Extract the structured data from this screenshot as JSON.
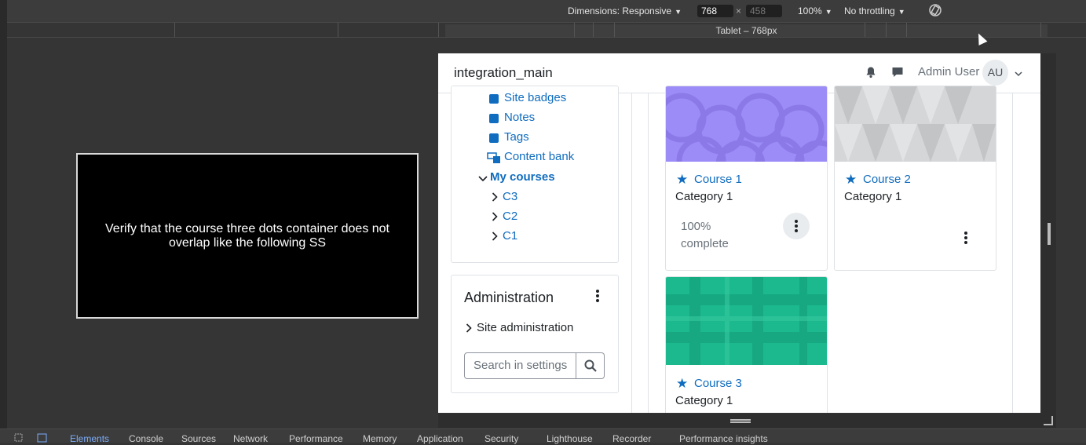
{
  "devtools_toolbar": {
    "dimensions_label": "Dimensions: Responsive",
    "width_value": "768",
    "height_placeholder": "458",
    "times_sign": "×",
    "zoom_label": "100%",
    "throttling_label": "No throttling",
    "rotate_icon": "rotate-icon"
  },
  "ruler": {
    "label": "Tablet – 768px"
  },
  "overlay": {
    "text": "Verify that the course three dots container does not overlap like the following SS"
  },
  "site": {
    "name": "integration_main",
    "user_name": "Admin User",
    "avatar_initials": "AU"
  },
  "nav": {
    "items": [
      {
        "label": "Site badges",
        "icon": "square-icon"
      },
      {
        "label": "Notes",
        "icon": "square-icon"
      },
      {
        "label": "Tags",
        "icon": "square-icon"
      },
      {
        "label": "Content bank",
        "icon": "content-bank-icon"
      }
    ],
    "my_courses": "My courses",
    "courses": [
      "C3",
      "C2",
      "C1"
    ]
  },
  "admin": {
    "title": "Administration",
    "site_admin": "Site administration",
    "search_placeholder": "Search in settings"
  },
  "courses": [
    {
      "name": "Course 1",
      "category": "Category 1",
      "progress_line1": "100%",
      "progress_line2": "complete",
      "color": "#9c8cf8"
    },
    {
      "name": "Course 2",
      "category": "Category 1",
      "color": "#d4d6d8"
    },
    {
      "name": "Course 3",
      "category": "Category 1",
      "color": "#1cb98f"
    }
  ],
  "devtools_tabs": [
    "Elements",
    "Console",
    "Sources",
    "Network",
    "Performance",
    "Memory",
    "Application",
    "Security",
    "Lighthouse",
    "Recorder",
    "Performance insights"
  ],
  "colors": {
    "link": "#0f6cbf",
    "active_tab": "#7cacf8"
  }
}
